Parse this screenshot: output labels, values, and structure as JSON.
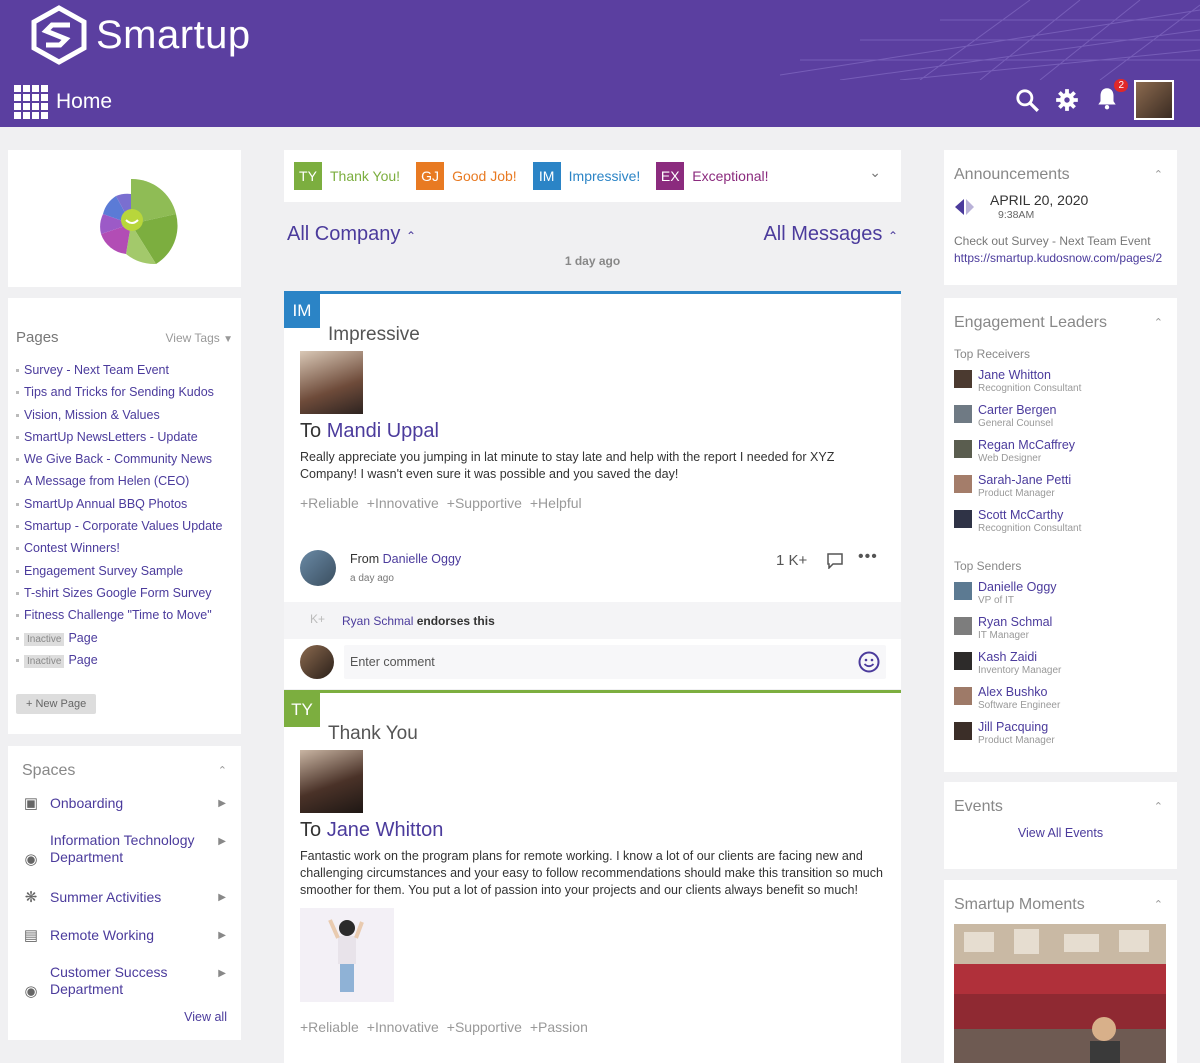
{
  "app": {
    "name": "Smartup",
    "page_title": "Home",
    "notification_count": "2"
  },
  "pages": {
    "title": "Pages",
    "view_tags": "View Tags",
    "items": [
      "Survey - Next Team Event",
      "Tips and Tricks for Sending Kudos",
      "Vision, Mission & Values",
      "SmartUp NewsLetters - Update",
      "We Give Back - Community News",
      "A Message from Helen (CEO)",
      "SmartUp Annual BBQ Photos",
      "Smartup - Corporate Values Update",
      "Contest Winners!",
      "Engagement Survey Sample",
      "T-shirt Sizes Google Form Survey",
      "Fitness Challenge \"Time to Move\""
    ],
    "inactive_label": "Inactive",
    "inactive_items": [
      "Page",
      "Page"
    ],
    "new_page": "+ New Page"
  },
  "spaces": {
    "title": "Spaces",
    "items": [
      {
        "label": "Onboarding"
      },
      {
        "label1": "Information Technology",
        "label2": "Department"
      },
      {
        "label": "Summer Activities"
      },
      {
        "label": "Remote Working"
      },
      {
        "label1": "Customer Success",
        "label2": "Department"
      }
    ],
    "view_all": "View all"
  },
  "kudos_types": [
    {
      "abbr": "TY",
      "label": "Thank You!",
      "color": "#7cae3f"
    },
    {
      "abbr": "GJ",
      "label": "Good Job!",
      "color": "#e87a22"
    },
    {
      "abbr": "IM",
      "label": "Impressive!",
      "color": "#2b84c6"
    },
    {
      "abbr": "EX",
      "label": "Exceptional!",
      "color": "#8b2b7e"
    }
  ],
  "filters": {
    "company": "All Company",
    "messages": "All Messages",
    "time": "1 day ago"
  },
  "posts": [
    {
      "abbr": "IM",
      "type": "Impressive",
      "to_prefix": "To",
      "to": "Mandi Uppal",
      "message": "Really appreciate you jumping in lat minute to stay late and help with the report I needed for XYZ Company! I wasn't even sure it was possible and you saved the day!",
      "values": [
        "+Reliable",
        "+Innovative",
        "+Supportive",
        "+Helpful"
      ],
      "from_prefix": "From",
      "from": "Danielle Oggy",
      "time": "a day ago",
      "count": "1 K+",
      "endorser": "Ryan Schmal",
      "endorse_text": "endorses this",
      "endorse_icon": "K+",
      "comment_placeholder": "Enter comment"
    },
    {
      "abbr": "TY",
      "type": "Thank You",
      "to_prefix": "To",
      "to": "Jane Whitton",
      "message": "Fantastic work on the program plans for remote working. I know a lot of our clients are facing new and challenging circumstances and your easy to follow recommendations should make this transition so much smoother for them. You put a lot of passion into your projects and our clients always benefit so much!",
      "values": [
        "+Reliable",
        "+Innovative",
        "+Supportive",
        "+Passion"
      ]
    }
  ],
  "announcements": {
    "title": "Announcements",
    "date": "APRIL 20, 2020",
    "time": "9:38AM",
    "text": "Check out Survey - Next Team Event",
    "link": "https://smartup.kudosnow.com/pages/2"
  },
  "leaders": {
    "title": "Engagement Leaders",
    "receivers_title": "Top Receivers",
    "receivers": [
      {
        "name": "Jane Whitton",
        "role": "Recognition Consultant"
      },
      {
        "name": "Carter Bergen",
        "role": "General Counsel"
      },
      {
        "name": "Regan McCaffrey",
        "role": "Web Designer"
      },
      {
        "name": "Sarah-Jane Petti",
        "role": "Product Manager"
      },
      {
        "name": "Scott McCarthy",
        "role": "Recognition Consultant"
      }
    ],
    "senders_title": "Top Senders",
    "senders": [
      {
        "name": "Danielle Oggy",
        "role": "VP of IT"
      },
      {
        "name": "Ryan Schmal",
        "role": "IT Manager"
      },
      {
        "name": "Kash Zaidi",
        "role": "Inventory Manager"
      },
      {
        "name": "Alex Bushko",
        "role": "Software Engineer"
      },
      {
        "name": "Jill Pacquing",
        "role": "Product Manager"
      }
    ]
  },
  "events": {
    "title": "Events",
    "view_all": "View All Events"
  },
  "moments": {
    "title": "Smartup Moments"
  },
  "colors": {
    "brand": "#5b3fa0",
    "link": "#4b3b9c",
    "impressive": "#2b84c6",
    "thankyou": "#7cae3f"
  }
}
